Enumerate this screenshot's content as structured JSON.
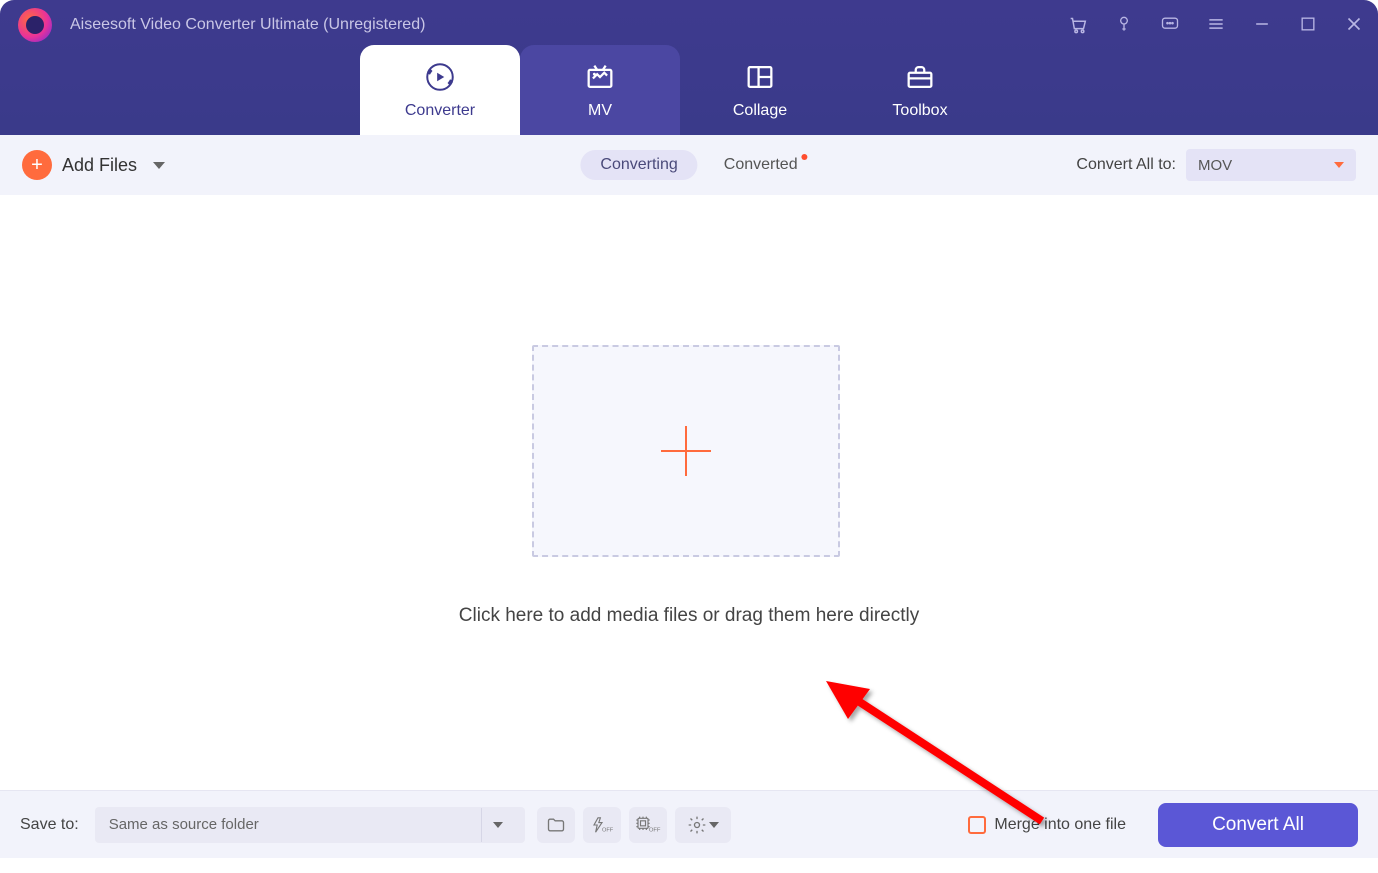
{
  "header": {
    "app_title": "Aiseesoft Video Converter Ultimate (Unregistered)",
    "tabs": [
      {
        "label": "Converter"
      },
      {
        "label": "MV"
      },
      {
        "label": "Collage"
      },
      {
        "label": "Toolbox"
      }
    ]
  },
  "toolbar": {
    "add_files_label": "Add Files",
    "converting_label": "Converting",
    "converted_label": "Converted",
    "convert_all_to_label": "Convert All to:",
    "format_selected": "MOV"
  },
  "main": {
    "drop_text": "Click here to add media files or drag them here directly"
  },
  "footer": {
    "save_to_label": "Save to:",
    "save_to_value": "Same as source folder",
    "merge_label": "Merge into one file",
    "convert_button_label": "Convert All"
  }
}
